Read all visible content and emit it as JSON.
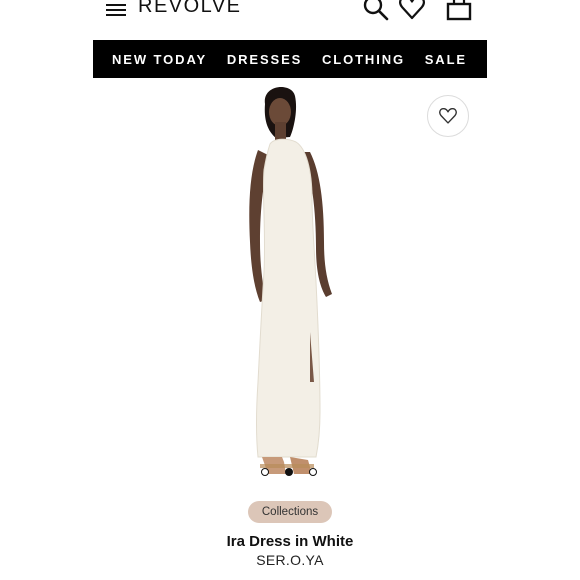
{
  "header": {
    "logo": "REVOLVE",
    "icons": [
      "menu-icon",
      "search-icon",
      "heart-icon",
      "bag-icon"
    ]
  },
  "nav": {
    "items": [
      {
        "label": "NEW TODAY"
      },
      {
        "label": "DRESSES"
      },
      {
        "label": "CLOTHING"
      },
      {
        "label": "SALE"
      }
    ]
  },
  "product": {
    "tag": "Collections",
    "title": "Ira Dress in White",
    "brand": "SER.O.YA",
    "image_count": 3,
    "active_image_index": 2
  },
  "colors": {
    "nav_bg": "#000000",
    "tag_bg": "#dcc6b8",
    "dress": "#f3efe6"
  }
}
